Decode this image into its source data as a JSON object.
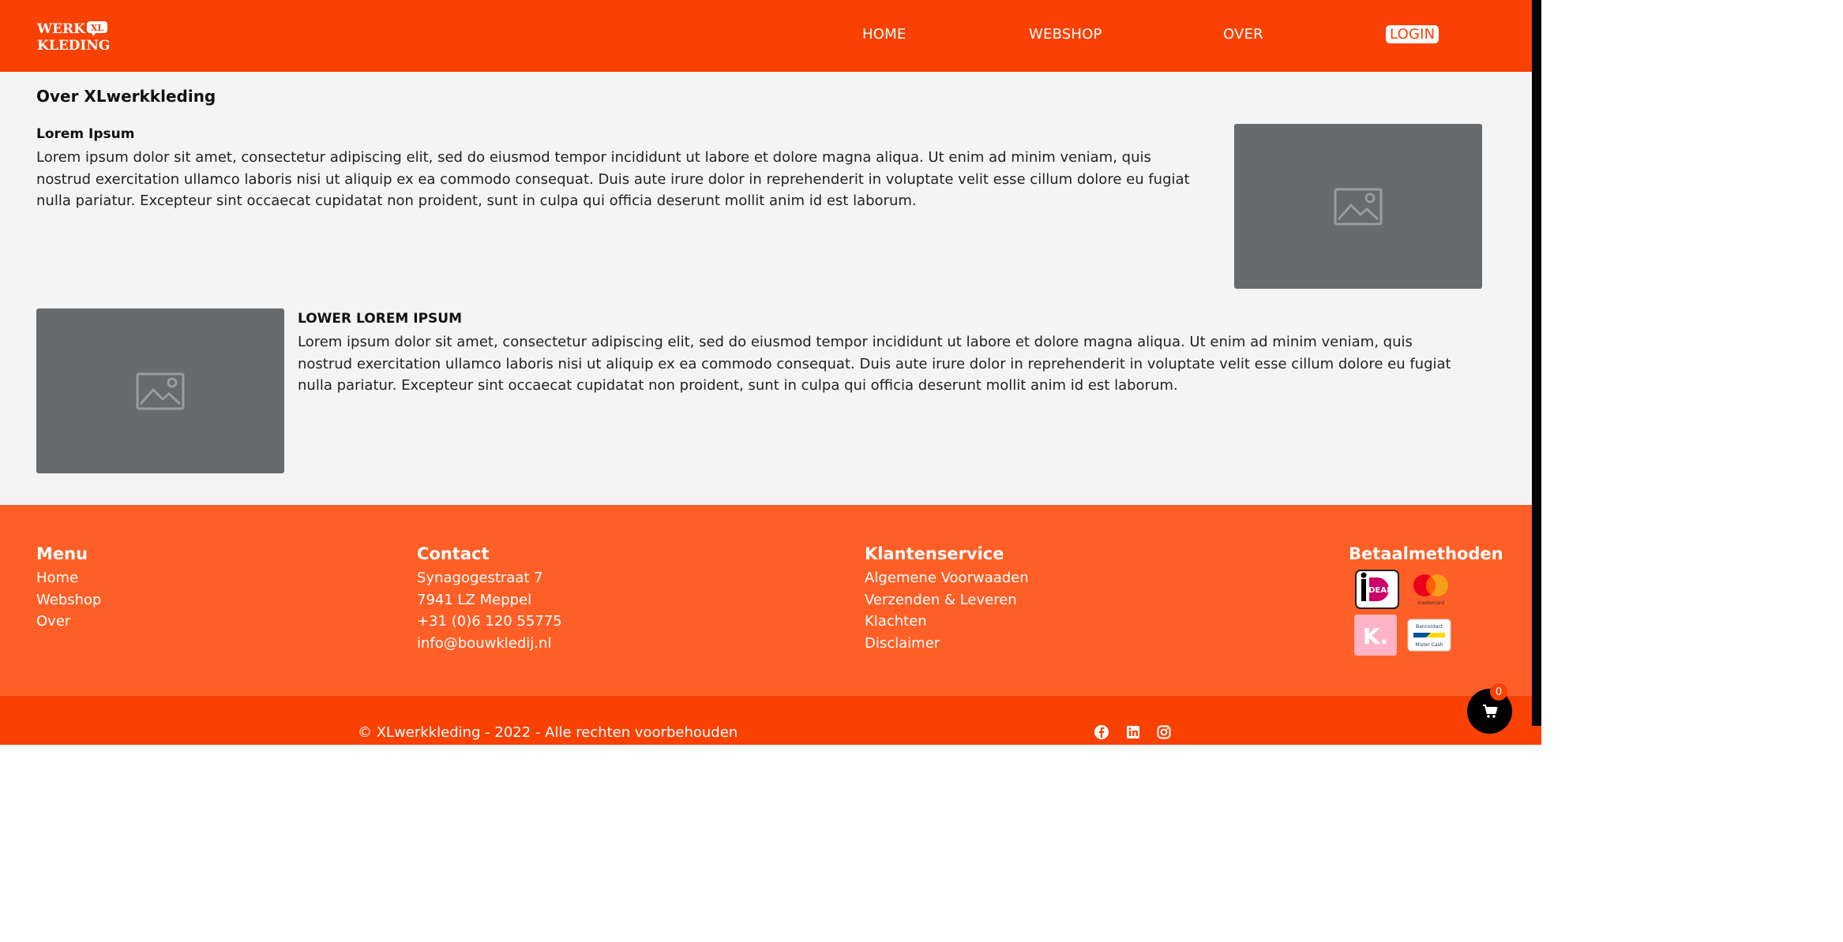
{
  "header": {
    "logo_text_top": "WERK",
    "logo_badge": "XL",
    "logo_text_bottom": "KLEDING",
    "nav": {
      "home": "HOME",
      "webshop": "WEBSHOP",
      "over": "OVER",
      "login": "LOGIN"
    }
  },
  "main": {
    "title": "Over XLwerkkleding",
    "section1": {
      "heading": "Lorem Ipsum",
      "text": "Lorem ipsum dolor sit amet, consectetur adipiscing elit, sed do eiusmod tempor incididunt ut labore et dolore magna aliqua. Ut enim ad minim veniam, quis nostrud exercitation ullamco laboris nisi ut aliquip ex ea commodo consequat. Duis aute irure dolor in reprehenderit in voluptate velit esse cillum dolore eu fugiat nulla pariatur. Excepteur sint occaecat cupidatat non proident, sunt in culpa qui officia deserunt mollit anim id est laborum."
    },
    "section2": {
      "heading": "LOWER LOREM IPSUM",
      "text": "Lorem ipsum dolor sit amet, consectetur adipiscing elit, sed do eiusmod tempor incididunt ut labore et dolore magna aliqua. Ut enim ad minim veniam, quis nostrud exercitation ullamco laboris nisi ut aliquip ex ea commodo consequat. Duis aute irure dolor in reprehenderit in voluptate velit esse cillum dolore eu fugiat nulla pariatur. Excepteur sint occaecat cupidatat non proident, sunt in culpa qui officia deserunt mollit anim id est laborum."
    },
    "image_icon": "image-placeholder-icon"
  },
  "footer": {
    "menu": {
      "heading": "Menu",
      "items": [
        "Home",
        "Webshop",
        "Over"
      ]
    },
    "contact": {
      "heading": "Contact",
      "lines": [
        "Synagogestraat 7",
        "7941 LZ Meppel",
        "+31 (0)6 120 55775",
        "info@bouwkledij.nl"
      ]
    },
    "klantenservice": {
      "heading": "Klantenservice",
      "items": [
        "Algemene Voorwaaden",
        "Verzenden & Leveren",
        "Klachten",
        "Disclaimer"
      ]
    },
    "betaalmethoden": {
      "heading": "Betaalmethoden",
      "methods": [
        "ideal-logo",
        "mastercard-logo",
        "klarna-logo",
        "bancontact-logo"
      ],
      "ideal_text": "iDEAL",
      "mastercard_text": "mastercard",
      "klarna_text": "K.",
      "bancontact_text_1": "Bancontact",
      "bancontact_text_2": "Mister Cash"
    }
  },
  "bottom": {
    "copyright": "© XLwerkkleding - 2022 - Alle rechten voorbehouden",
    "social": [
      "facebook-icon",
      "linkedin-icon",
      "instagram-icon"
    ]
  },
  "cart": {
    "count": "0",
    "icon": "cart-icon"
  },
  "colors": {
    "brand_orange": "#f94104",
    "footer_orange": "#fe5f26",
    "page_background": "#f4f4f4",
    "placeholder_gray": "#676b6e"
  }
}
